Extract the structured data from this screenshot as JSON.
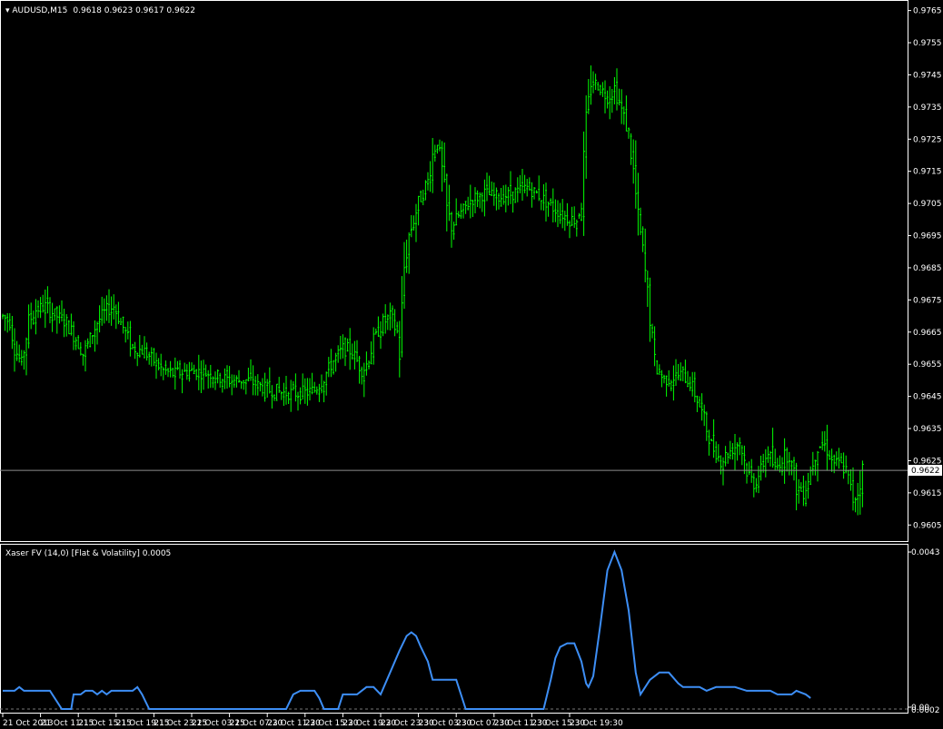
{
  "header": {
    "symbol": "AUDUSD,M15",
    "ohlc": "0.9618 0.9623 0.9617 0.9622"
  },
  "indicator": {
    "label": "Xaser FV (14,0) [Flat & Volatility] 0.0005"
  },
  "colors": {
    "background": "#000000",
    "candles": "#00ff00",
    "indicator_line": "#3d8ef5",
    "frame": "#ffffff"
  },
  "chart_data": [
    {
      "type": "candlestick",
      "title": "AUDUSD,M15",
      "current_price": 0.9622,
      "current_price_label": "0.9622",
      "ylim": [
        0.96,
        0.9768
      ],
      "y_ticks": [
        "0.9765",
        "0.9755",
        "0.9745",
        "0.9735",
        "0.9725",
        "0.9715",
        "0.9705",
        "0.9695",
        "0.9685",
        "0.9675",
        "0.9665",
        "0.9655",
        "0.9645",
        "0.9635",
        "0.9625",
        "0.9615",
        "0.9605"
      ],
      "x_ticks": [
        "21 Oct 2013",
        "21 Oct 11:15",
        "21 Oct 15:15",
        "21 Oct 19:15",
        "21 Oct 23:15",
        "22 Oct 03:15",
        "22 Oct 07:30",
        "22 Oct 11:30",
        "22 Oct 15:30",
        "22 Oct 19:30",
        "22 Oct 23:30",
        "23 Oct 03:30",
        "23 Oct 07:30",
        "23 Oct 11:30",
        "23 Oct 15:30",
        "23 Oct 19:30"
      ],
      "bars_per_tick": 16,
      "close_path": [
        [
          0,
          0.967
        ],
        [
          3,
          0.9668
        ],
        [
          5,
          0.966
        ],
        [
          8,
          0.9655
        ],
        [
          11,
          0.9668
        ],
        [
          14,
          0.9672
        ],
        [
          18,
          0.9673
        ],
        [
          23,
          0.967
        ],
        [
          27,
          0.9668
        ],
        [
          31,
          0.9663
        ],
        [
          34,
          0.9658
        ],
        [
          37,
          0.9663
        ],
        [
          40,
          0.9668
        ],
        [
          44,
          0.9672
        ],
        [
          47,
          0.9673
        ],
        [
          50,
          0.9668
        ],
        [
          55,
          0.966
        ],
        [
          60,
          0.9659
        ],
        [
          64,
          0.9656
        ],
        [
          68,
          0.9653
        ],
        [
          72,
          0.9652
        ],
        [
          80,
          0.9653
        ],
        [
          88,
          0.9652
        ],
        [
          96,
          0.965
        ],
        [
          104,
          0.965
        ],
        [
          112,
          0.9647
        ],
        [
          120,
          0.9646
        ],
        [
          128,
          0.9646
        ],
        [
          132,
          0.9647
        ],
        [
          136,
          0.9651
        ],
        [
          140,
          0.9656
        ],
        [
          144,
          0.966
        ],
        [
          148,
          0.9659
        ],
        [
          152,
          0.9653
        ],
        [
          154,
          0.9655
        ],
        [
          157,
          0.9662
        ],
        [
          160,
          0.9667
        ],
        [
          164,
          0.967
        ],
        [
          167,
          0.9665
        ],
        [
          168,
          0.9658
        ],
        [
          170,
          0.9685
        ],
        [
          172,
          0.9695
        ],
        [
          176,
          0.9705
        ],
        [
          180,
          0.9712
        ],
        [
          182,
          0.972
        ],
        [
          184,
          0.9725
        ],
        [
          186,
          0.9715
        ],
        [
          188,
          0.9703
        ],
        [
          190,
          0.9698
        ],
        [
          194,
          0.9702
        ],
        [
          198,
          0.9706
        ],
        [
          204,
          0.9708
        ],
        [
          210,
          0.9707
        ],
        [
          216,
          0.9708
        ],
        [
          222,
          0.971
        ],
        [
          228,
          0.9707
        ],
        [
          234,
          0.9703
        ],
        [
          240,
          0.97
        ],
        [
          243,
          0.97
        ],
        [
          245,
          0.9705
        ],
        [
          247,
          0.973
        ],
        [
          249,
          0.9743
        ],
        [
          252,
          0.9742
        ],
        [
          256,
          0.9738
        ],
        [
          259,
          0.9741
        ],
        [
          262,
          0.9734
        ],
        [
          265,
          0.9727
        ],
        [
          267,
          0.9715
        ],
        [
          269,
          0.97
        ],
        [
          271,
          0.969
        ],
        [
          274,
          0.967
        ],
        [
          276,
          0.9655
        ],
        [
          280,
          0.965
        ],
        [
          284,
          0.9651
        ],
        [
          288,
          0.9652
        ],
        [
          292,
          0.9648
        ],
        [
          296,
          0.964
        ],
        [
          300,
          0.963
        ],
        [
          304,
          0.9625
        ],
        [
          308,
          0.9628
        ],
        [
          312,
          0.9631
        ],
        [
          315,
          0.9622
        ],
        [
          318,
          0.9618
        ],
        [
          321,
          0.9622
        ],
        [
          324,
          0.9628
        ],
        [
          327,
          0.9622
        ],
        [
          330,
          0.9626
        ],
        [
          333,
          0.9627
        ],
        [
          336,
          0.9617
        ],
        [
          339,
          0.9615
        ],
        [
          342,
          0.9622
        ],
        [
          345,
          0.963
        ],
        [
          348,
          0.963
        ],
        [
          351,
          0.9625
        ],
        [
          354,
          0.9624
        ],
        [
          357,
          0.9622
        ],
        [
          360,
          0.9613
        ],
        [
          362,
          0.9615
        ],
        [
          364,
          0.9622
        ]
      ]
    },
    {
      "type": "line",
      "title": "Xaser FV (14,0) [Flat & Volatility] 0.0005",
      "series": [
        {
          "name": "Xaser FV (14,0)",
          "values_by_bar": [
            [
              0,
              0.0005
            ],
            [
              5,
              0.0005
            ],
            [
              7,
              0.0006
            ],
            [
              9,
              0.0005
            ],
            [
              20,
              0.0005
            ],
            [
              22,
              0.0003
            ],
            [
              25,
              0.0
            ],
            [
              29,
              0.0
            ],
            [
              30,
              0.0004
            ],
            [
              33,
              0.0004
            ],
            [
              35,
              0.0005
            ],
            [
              38,
              0.0005
            ],
            [
              40,
              0.0004
            ],
            [
              42,
              0.0005
            ],
            [
              44,
              0.0004
            ],
            [
              46,
              0.0005
            ],
            [
              55,
              0.0005
            ],
            [
              57,
              0.0006
            ],
            [
              59,
              0.0004
            ],
            [
              62,
              0.0
            ],
            [
              120,
              0.0
            ],
            [
              123,
              0.0004
            ],
            [
              126,
              0.0005
            ],
            [
              132,
              0.0005
            ],
            [
              134,
              0.0003
            ],
            [
              136,
              0.0
            ],
            [
              142,
              0.0
            ],
            [
              144,
              0.0004
            ],
            [
              150,
              0.0004
            ],
            [
              154,
              0.0006
            ],
            [
              157,
              0.0006
            ],
            [
              160,
              0.0004
            ],
            [
              162,
              0.0007
            ],
            [
              164,
              0.001
            ],
            [
              168,
              0.0016
            ],
            [
              171,
              0.002
            ],
            [
              173,
              0.0021
            ],
            [
              175,
              0.002
            ],
            [
              177,
              0.0017
            ],
            [
              180,
              0.0013
            ],
            [
              182,
              0.0008
            ],
            [
              186,
              0.0008
            ],
            [
              192,
              0.0008
            ],
            [
              196,
              0.0
            ],
            [
              216,
              0.0
            ],
            [
              229,
              0.0
            ],
            [
              232,
              0.0008
            ],
            [
              234,
              0.0014
            ],
            [
              236,
              0.0017
            ],
            [
              239,
              0.0018
            ],
            [
              242,
              0.0018
            ],
            [
              245,
              0.0013
            ],
            [
              247,
              0.0007
            ],
            [
              248,
              0.0006
            ],
            [
              250,
              0.0009
            ],
            [
              253,
              0.0023
            ],
            [
              256,
              0.0038
            ],
            [
              259,
              0.0043
            ],
            [
              262,
              0.0038
            ],
            [
              265,
              0.0027
            ],
            [
              268,
              0.001
            ],
            [
              270,
              0.0004
            ],
            [
              274,
              0.0008
            ],
            [
              278,
              0.001
            ],
            [
              282,
              0.001
            ],
            [
              286,
              0.0007
            ],
            [
              288,
              0.0006
            ],
            [
              295,
              0.0006
            ],
            [
              298,
              0.0005
            ],
            [
              302,
              0.0006
            ],
            [
              310,
              0.0006
            ],
            [
              315,
              0.0005
            ],
            [
              325,
              0.0005
            ],
            [
              328,
              0.0004
            ],
            [
              334,
              0.0004
            ],
            [
              336,
              0.0005
            ],
            [
              340,
              0.0004
            ],
            [
              342,
              0.0003
            ]
          ]
        }
      ],
      "ylim": [
        -0.0001,
        0.0045
      ],
      "y_ticks": [
        "0.0043",
        "0.00",
        "0.0002"
      ]
    }
  ]
}
